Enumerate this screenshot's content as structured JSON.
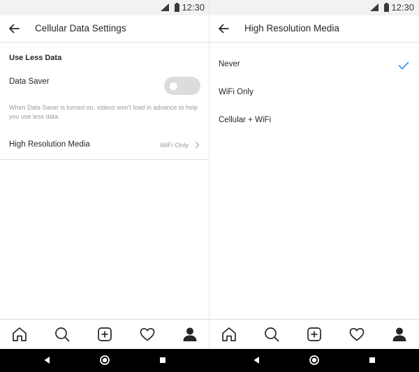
{
  "status_bar": {
    "time": "12:30"
  },
  "cellular_screen": {
    "title": "Cellular Data Settings",
    "section_title": "Use Less Data",
    "data_saver_label": "Data Saver",
    "data_saver_enabled": false,
    "data_saver_description": "When Data Saver is turned on, videos won't load in advance to help you use less data.",
    "high_res_label": "High Resolution Media",
    "high_res_value": "WiFi Only"
  },
  "media_screen": {
    "title": "High Resolution Media",
    "options": [
      {
        "label": "Never",
        "selected": true
      },
      {
        "label": "WiFi Only",
        "selected": false
      },
      {
        "label": "Cellular + WiFi",
        "selected": false
      }
    ]
  },
  "tab_bar": {
    "tabs": [
      "home-icon",
      "search-icon",
      "add-post-icon",
      "heart-icon",
      "profile-icon"
    ]
  },
  "nav_bar": {
    "buttons": [
      "back-triangle-icon",
      "home-circle-icon",
      "recents-square-icon"
    ]
  },
  "colors": {
    "accent_check": "#3897f0",
    "toggle_off": "#dcdcdc",
    "status_bar_bg": "#f2f2f2"
  }
}
